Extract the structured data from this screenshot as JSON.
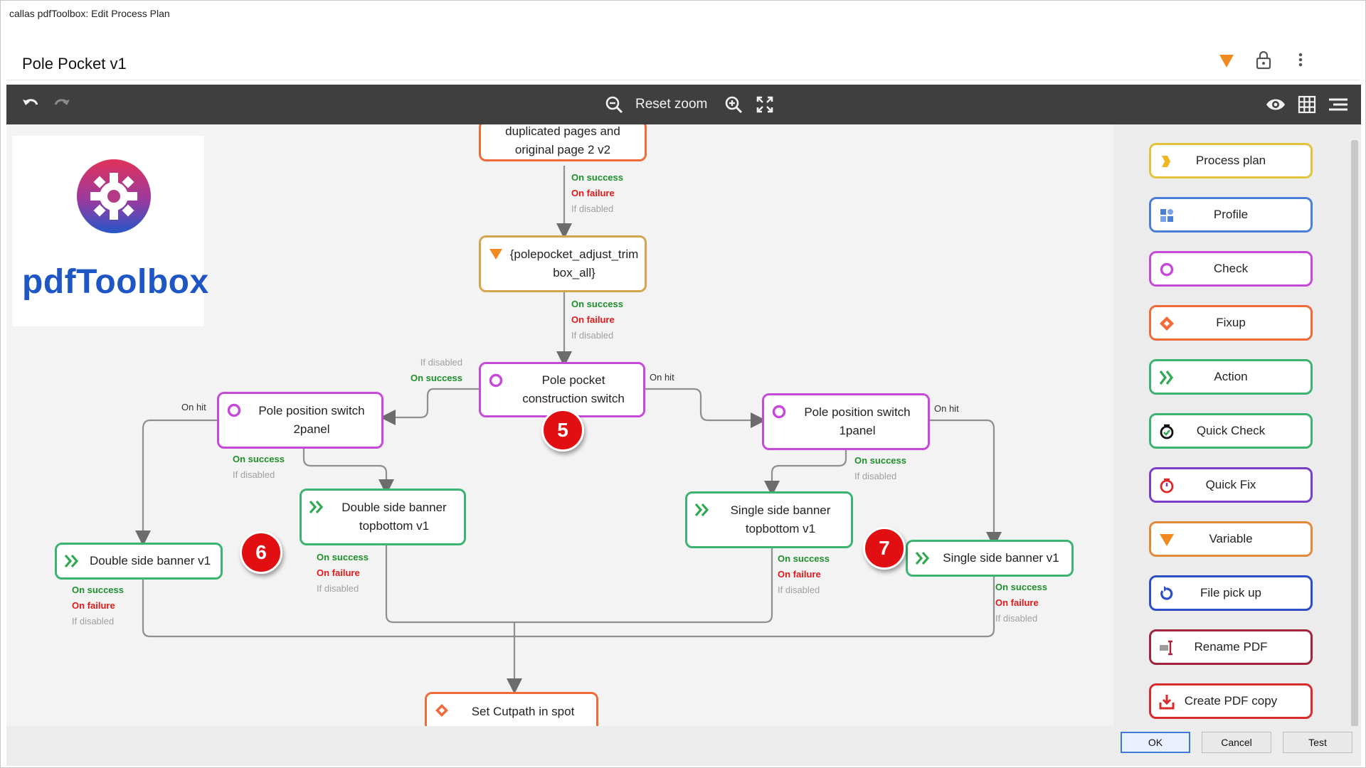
{
  "window": {
    "title": "callas pdfToolbox: Edit Process Plan"
  },
  "plan": {
    "name": "Pole Pocket v1"
  },
  "toolbar": {
    "zoom_label": "Reset zoom"
  },
  "logo": {
    "text": "pdfToolbox"
  },
  "nodes": {
    "top_partial": "duplicated pages and original page 2 v2",
    "variable": "{polepocket_adjust_trim box_all}",
    "pole_pocket_switch": "Pole pocket construction switch",
    "switch_2panel": "Pole position switch 2panel",
    "switch_1panel": "Pole position switch 1panel",
    "double_topbottom": "Double side banner topbottom v1",
    "single_topbottom": "Single side banner topbottom v1",
    "double_side": "Double side banner v1",
    "single_side": "Single side banner v1",
    "cutpath": "Set Cutpath in spot"
  },
  "flow_labels": {
    "on_success": "On success",
    "on_failure": "On failure",
    "if_disabled": "If disabled",
    "on_hit": "On hit"
  },
  "badges": [
    "5",
    "6",
    "7"
  ],
  "palette": [
    {
      "label": "Process plan",
      "color": "#e3c33a",
      "icon": "process-plan-icon"
    },
    {
      "label": "Profile",
      "color": "#4a7fd8",
      "icon": "profile-icon"
    },
    {
      "label": "Check",
      "color": "#c64ad8",
      "icon": "check-icon"
    },
    {
      "label": "Fixup",
      "color": "#f06a3a",
      "icon": "fixup-icon"
    },
    {
      "label": "Action",
      "color": "#3cb371",
      "icon": "action-icon"
    },
    {
      "label": "Quick Check",
      "color": "#3cb371",
      "icon": "quick-check-icon"
    },
    {
      "label": "Quick Fix",
      "color": "#7a3fc8",
      "icon": "quick-fix-icon"
    },
    {
      "label": "Variable",
      "color": "#e08a3a",
      "icon": "variable-icon"
    },
    {
      "label": "File pick up",
      "color": "#2c4fc8",
      "icon": "file-pickup-icon"
    },
    {
      "label": "Rename PDF",
      "color": "#a3243f",
      "icon": "rename-pdf-icon"
    },
    {
      "label": "Create PDF copy",
      "color": "#d92b2b",
      "icon": "create-pdf-copy-icon"
    }
  ],
  "footer": {
    "ok": "OK",
    "cancel": "Cancel",
    "test": "Test"
  },
  "colors": {
    "toolbar_bg": "#3f3f3f",
    "check": "#c64ad8",
    "action": "#3cb371",
    "fixup": "#f06a3a",
    "variable": "#d4a54c",
    "badge": "#e10f12"
  }
}
